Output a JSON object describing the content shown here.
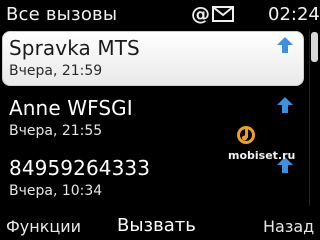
{
  "status": {
    "title": "Все вызовы",
    "time": "02:24",
    "icons": [
      "at-icon",
      "envelope-icon"
    ]
  },
  "calls": [
    {
      "name": "Spravka MTS",
      "time": "Вчера, 21:59",
      "icon": "outgoing-call-arrow-icon",
      "selected": true
    },
    {
      "name": "Anne WFSGI",
      "time": "Вчера, 21:55",
      "icon": "outgoing-call-arrow-icon",
      "selected": false
    },
    {
      "name": "84959264333",
      "time": "Вчера, 10:34",
      "icon": "outgoing-call-arrow-icon",
      "selected": false
    }
  ],
  "softkeys": {
    "left": "Функции",
    "center": "Вызвать",
    "right": "Назад"
  },
  "watermark": {
    "text": "mobiset.ru"
  },
  "colors": {
    "background": "#000000",
    "selection": "#ffffff",
    "arrow": "#3d8fe0",
    "watermark_logo": "#f0a020"
  }
}
